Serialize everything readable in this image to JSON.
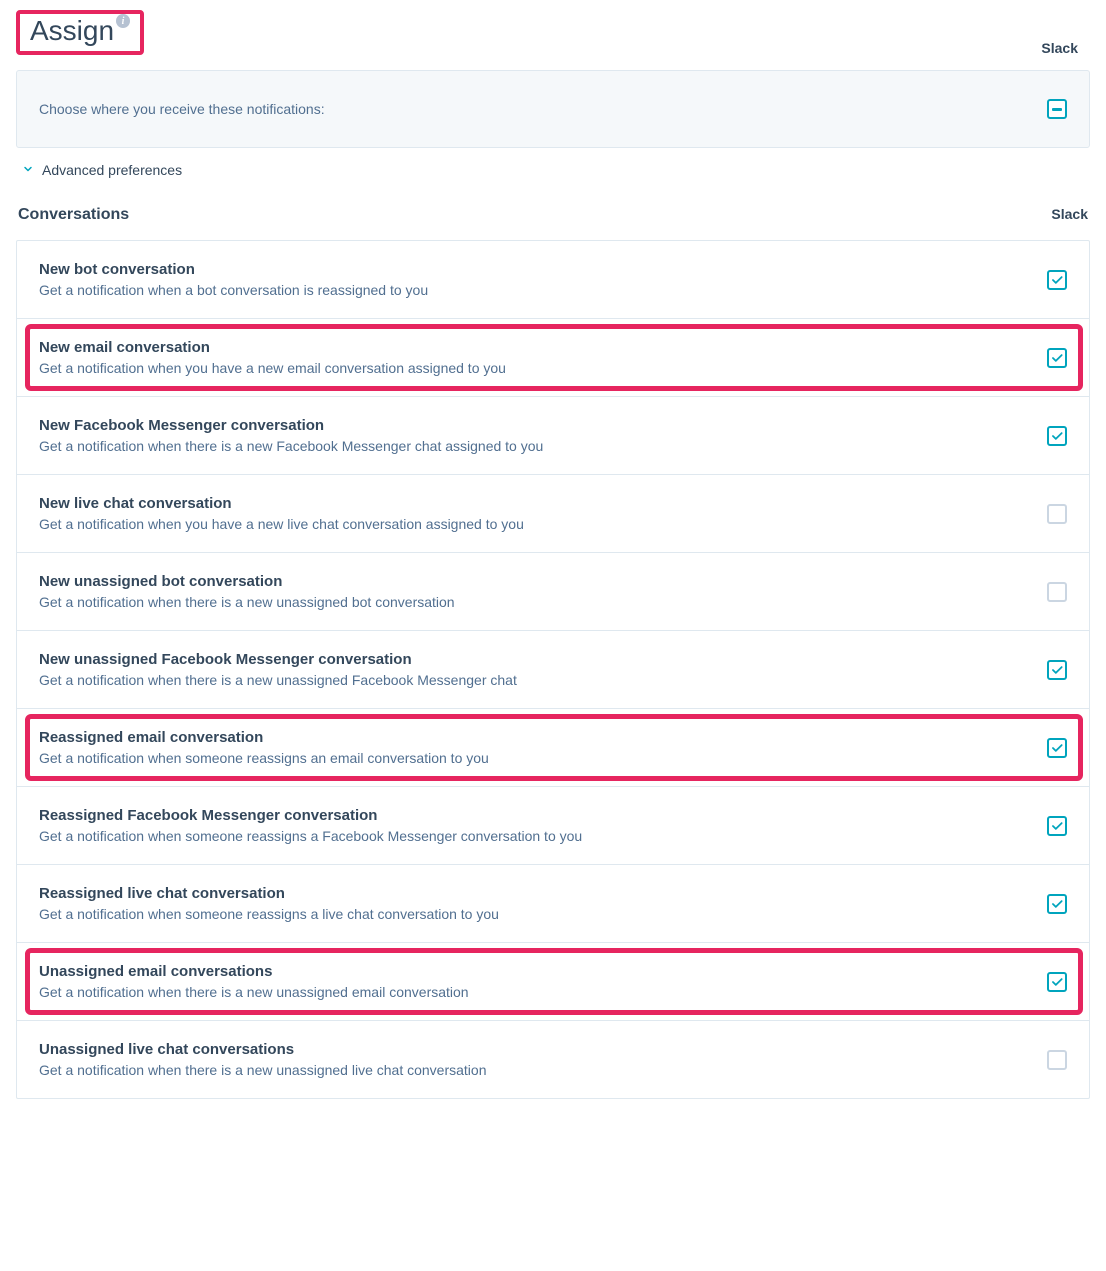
{
  "title": "Assign",
  "slack_label": "Slack",
  "notice_text": "Choose where you receive these notifications:",
  "advanced_label": "Advanced preferences",
  "section_title": "Conversations",
  "section_slack_label": "Slack",
  "title_highlighted": true,
  "rows": [
    {
      "title": "New bot conversation",
      "desc": "Get a notification when a bot conversation is reassigned to you",
      "checked": true,
      "highlighted": false
    },
    {
      "title": "New email conversation",
      "desc": "Get a notification when you have a new email conversation assigned to you",
      "checked": true,
      "highlighted": true
    },
    {
      "title": "New Facebook Messenger conversation",
      "desc": "Get a notification when there is a new Facebook Messenger chat assigned to you",
      "checked": true,
      "highlighted": false
    },
    {
      "title": "New live chat conversation",
      "desc": "Get a notification when you have a new live chat conversation assigned to you",
      "checked": false,
      "highlighted": false
    },
    {
      "title": "New unassigned bot conversation",
      "desc": "Get a notification when there is a new unassigned bot conversation",
      "checked": false,
      "highlighted": false
    },
    {
      "title": "New unassigned Facebook Messenger conversation",
      "desc": "Get a notification when there is a new unassigned Facebook Messenger chat",
      "checked": true,
      "highlighted": false
    },
    {
      "title": "Reassigned email conversation",
      "desc": "Get a notification when someone reassigns an email conversation to you",
      "checked": true,
      "highlighted": true
    },
    {
      "title": "Reassigned Facebook Messenger conversation",
      "desc": "Get a notification when someone reassigns a Facebook Messenger conversation to you",
      "checked": true,
      "highlighted": false
    },
    {
      "title": "Reassigned live chat conversation",
      "desc": "Get a notification when someone reassigns a live chat conversation to you",
      "checked": true,
      "highlighted": false
    },
    {
      "title": "Unassigned email conversations",
      "desc": "Get a notification when there is a new unassigned email conversation",
      "checked": true,
      "highlighted": true
    },
    {
      "title": "Unassigned live chat conversations",
      "desc": "Get a notification when there is a new unassigned live chat conversation",
      "checked": false,
      "highlighted": false
    }
  ]
}
